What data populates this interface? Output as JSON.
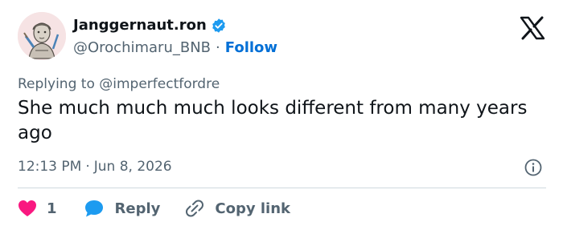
{
  "author": {
    "display_name": "Janggernaut.ron",
    "handle": "@Orochimaru_BNB",
    "separator": "·",
    "follow_label": "Follow"
  },
  "reply_context": {
    "prefix": "Replying to",
    "mention": "@imperfectfordre"
  },
  "tweet": {
    "text": "She much much much looks different from many years ago",
    "time": "12:13 PM",
    "separator": "·",
    "date": "Jun 8, 2026"
  },
  "actions": {
    "like_count": "1",
    "reply_label": "Reply",
    "copy_link_label": "Copy link"
  },
  "icons": {
    "verified": "verified-badge-icon",
    "brand": "x-logo-icon",
    "info": "info-icon",
    "like": "heart-icon",
    "reply": "speech-bubble-icon",
    "copy": "link-icon"
  },
  "colors": {
    "link_blue": "#006fd6",
    "verified_blue": "#1d9bf0",
    "heart_pink": "#f91880",
    "text_primary": "#0f1419",
    "text_secondary": "#536471",
    "divider": "#cfd9de"
  }
}
